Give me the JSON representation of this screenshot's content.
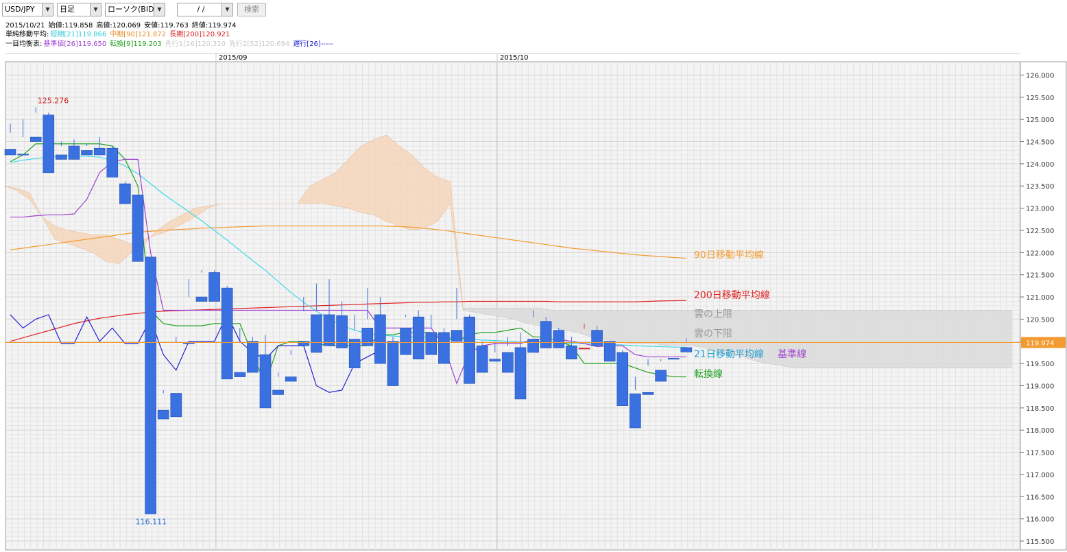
{
  "toolbar": {
    "pair": "USD/JPY",
    "period": "日足",
    "chart_kind": "ローソク(BID)",
    "date": "/ /",
    "search_label": "検索"
  },
  "info": {
    "date": "2015/10/21",
    "open": "始値:119.858",
    "high": "高値:120.069",
    "low": "安値:119.763",
    "close": "終値:119.974",
    "sma_label": "単純移動平均:",
    "sma_short": "短期[21]119.866",
    "sma_mid": "中期[90]121.872",
    "sma_long": "長期[200]120.921",
    "ichimoku_label": "一目均衡表:",
    "kijun": "基準値[26]119.650",
    "tenkan": "転換[9]119.203",
    "senkou1": "先行1[26]120.310",
    "senkou2": "先行2[52]120.694",
    "chikou": "遅行[26]-----"
  },
  "colors": {
    "up": "#e83030",
    "down": "#3a70e0",
    "sma21": "#40d8e8",
    "sma90": "#f39a30",
    "sma200": "#e02020",
    "kijun": "#a040d0",
    "tenkan": "#20a020",
    "chikou": "#2020d0",
    "cloud": "#f5d5bb",
    "cloud_gray": "#dcdcdc",
    "price_line": "#f39a30"
  },
  "chart_data": {
    "type": "candlestick",
    "pair": "USD/JPY",
    "months": [
      "2015/09",
      "2015/10"
    ],
    "ylim": [
      115.3,
      126.3
    ],
    "yticks": [
      "126.000",
      "125.500",
      "125.000",
      "124.500",
      "124.000",
      "123.500",
      "123.000",
      "122.500",
      "122.000",
      "121.500",
      "121.000",
      "120.500",
      "120.000",
      "119.500",
      "119.000",
      "118.500",
      "118.000",
      "117.500",
      "117.000",
      "116.500",
      "116.000",
      "115.500"
    ],
    "current_price": "119.974",
    "high_label": "125.276",
    "low_label": "116.111",
    "candles": [
      [
        124.33,
        124.9,
        124.7,
        124.2
      ],
      [
        124.22,
        125.0,
        124.6,
        124.2
      ],
      [
        124.6,
        125.276,
        125.15,
        124.5
      ],
      [
        125.1,
        125.15,
        124.2,
        123.8
      ],
      [
        124.2,
        124.5,
        124.4,
        124.1
      ],
      [
        124.4,
        124.55,
        124.3,
        124.1
      ],
      [
        124.3,
        124.45,
        124.4,
        124.2
      ],
      [
        124.35,
        124.6,
        124.35,
        124.2
      ],
      [
        124.35,
        124.4,
        123.9,
        123.7
      ],
      [
        123.55,
        123.6,
        123.15,
        123.1
      ],
      [
        123.3,
        123.3,
        122.0,
        121.8
      ],
      [
        121.9,
        121.9,
        118.45,
        116.111
      ],
      [
        118.45,
        118.9,
        118.83,
        118.25
      ],
      [
        118.83,
        120.1,
        119.97,
        118.3
      ],
      [
        119.97,
        121.4,
        121.0,
        119.95
      ],
      [
        121.0,
        121.6,
        121.55,
        120.9
      ],
      [
        121.55,
        121.6,
        121.2,
        120.9
      ],
      [
        121.2,
        121.25,
        119.35,
        119.15
      ],
      [
        119.3,
        120.3,
        120.0,
        119.2
      ],
      [
        120.0,
        120.1,
        119.7,
        119.3
      ],
      [
        119.7,
        120.15,
        119.05,
        118.5
      ],
      [
        118.9,
        119.3,
        119.2,
        118.8
      ],
      [
        119.2,
        119.8,
        119.7,
        119.1
      ],
      [
        120.0,
        121.0,
        120.68,
        119.9
      ],
      [
        120.6,
        121.3,
        120.7,
        119.75
      ],
      [
        120.6,
        121.4,
        120.55,
        119.9
      ],
      [
        120.58,
        120.9,
        120.26,
        119.85
      ],
      [
        120.05,
        120.6,
        120.25,
        119.4
      ],
      [
        120.3,
        121.2,
        120.5,
        119.9
      ],
      [
        120.6,
        121.0,
        120.0,
        119.5
      ],
      [
        120.0,
        120.1,
        119.95,
        119.0
      ],
      [
        120.3,
        120.6,
        120.55,
        119.7
      ],
      [
        120.55,
        120.7,
        120.15,
        119.6
      ],
      [
        120.2,
        120.6,
        120.3,
        119.7
      ],
      [
        120.2,
        120.3,
        120.0,
        119.5
      ],
      [
        120.25,
        121.2,
        120.5,
        120.0
      ],
      [
        120.55,
        120.6,
        119.9,
        119.05
      ],
      [
        119.9,
        120.0,
        119.75,
        119.3
      ],
      [
        119.6,
        120.0,
        119.75,
        119.55
      ],
      [
        119.75,
        120.1,
        119.9,
        119.3
      ],
      [
        119.86,
        120.2,
        119.85,
        118.7
      ],
      [
        120.05,
        120.7,
        120.55,
        119.75
      ],
      [
        120.45,
        120.55,
        120.15,
        119.85
      ],
      [
        120.25,
        120.3,
        120.0,
        119.85
      ],
      [
        119.9,
        120.1,
        119.75,
        119.6
      ],
      [
        119.85,
        120.4,
        120.28,
        119.85
      ],
      [
        120.25,
        120.35,
        120.1,
        119.9
      ],
      [
        120.0,
        120.0,
        119.72,
        119.55
      ],
      [
        119.75,
        119.8,
        118.85,
        118.55
      ],
      [
        118.82,
        119.2,
        118.9,
        118.05
      ],
      [
        118.85,
        119.6,
        119.45,
        118.8
      ],
      [
        119.35,
        119.6,
        119.55,
        119.1
      ],
      [
        119.62,
        120.0,
        119.97,
        119.6
      ],
      [
        119.86,
        120.07,
        119.97,
        119.76
      ]
    ],
    "sma21": [
      124.03,
      124.08,
      124.12,
      124.15,
      124.17,
      124.18,
      124.17,
      124.15,
      124.08,
      123.95,
      123.78,
      123.55,
      123.32,
      123.12,
      122.92,
      122.72,
      122.5,
      122.28,
      122.05,
      121.82,
      121.6,
      121.35,
      121.1,
      120.88,
      120.68,
      120.5,
      120.36,
      120.25,
      120.18,
      120.14,
      120.12,
      120.1,
      120.1,
      120.1,
      120.08,
      120.07,
      120.05,
      120.03,
      120.02,
      120.0,
      119.98,
      119.98,
      119.98,
      119.97,
      119.95,
      119.95,
      119.94,
      119.93,
      119.92,
      119.9,
      119.89,
      119.88,
      119.87,
      119.866
    ],
    "sma90": [
      122.06,
      122.1,
      122.14,
      122.18,
      122.22,
      122.26,
      122.3,
      122.34,
      122.38,
      122.42,
      122.46,
      122.48,
      122.5,
      122.52,
      122.53,
      122.55,
      122.56,
      122.57,
      122.58,
      122.59,
      122.6,
      122.6,
      122.6,
      122.6,
      122.6,
      122.6,
      122.6,
      122.6,
      122.6,
      122.6,
      122.59,
      122.58,
      122.56,
      122.53,
      122.5,
      122.46,
      122.42,
      122.38,
      122.34,
      122.3,
      122.26,
      122.22,
      122.18,
      122.14,
      122.1,
      122.07,
      122.04,
      122.01,
      121.98,
      121.95,
      121.93,
      121.91,
      121.89,
      121.872
    ],
    "sma200": [
      120.0,
      120.08,
      120.16,
      120.24,
      120.32,
      120.4,
      120.46,
      120.52,
      120.56,
      120.6,
      120.63,
      120.66,
      120.68,
      120.69,
      120.7,
      120.71,
      120.72,
      120.73,
      120.74,
      120.75,
      120.76,
      120.77,
      120.78,
      120.79,
      120.8,
      120.81,
      120.82,
      120.83,
      120.84,
      120.85,
      120.86,
      120.87,
      120.88,
      120.88,
      120.89,
      120.89,
      120.9,
      120.9,
      120.9,
      120.9,
      120.9,
      120.9,
      120.9,
      120.89,
      120.89,
      120.89,
      120.89,
      120.89,
      120.89,
      120.89,
      120.9,
      120.91,
      120.915,
      120.921
    ],
    "kijun": [
      122.8,
      122.8,
      122.83,
      122.85,
      122.85,
      122.87,
      123.2,
      123.8,
      124.05,
      124.1,
      124.1,
      122.0,
      120.7,
      120.7,
      120.7,
      120.7,
      120.7,
      120.7,
      120.7,
      120.7,
      120.7,
      120.7,
      120.7,
      120.7,
      120.7,
      120.7,
      120.7,
      120.7,
      120.7,
      120.3,
      120.3,
      120.3,
      120.3,
      120.3,
      119.9,
      119.05,
      119.75,
      119.9,
      119.95,
      119.95,
      119.95,
      120.05,
      120.05,
      120.05,
      120.0,
      119.95,
      119.88,
      119.9,
      119.9,
      119.7,
      119.65,
      119.65,
      119.65,
      119.65
    ],
    "tenkan": [
      124.05,
      124.2,
      124.45,
      124.45,
      124.45,
      124.45,
      124.45,
      124.45,
      124.4,
      124.1,
      123.5,
      120.7,
      120.4,
      120.35,
      120.35,
      120.35,
      120.4,
      120.4,
      120.4,
      119.7,
      119.05,
      119.9,
      120.0,
      120.0,
      119.95,
      119.9,
      119.9,
      119.9,
      119.9,
      120.15,
      120.15,
      120.2,
      120.2,
      120.2,
      120.1,
      120.0,
      120.15,
      120.2,
      120.2,
      120.25,
      120.3,
      120.1,
      120.1,
      120.0,
      119.9,
      119.5,
      119.5,
      119.5,
      119.5,
      119.4,
      119.3,
      119.25,
      119.2,
      119.2
    ],
    "chikou": [
      120.6,
      120.3,
      120.5,
      120.6,
      119.95,
      119.95,
      120.55,
      120.0,
      120.3,
      119.95,
      119.95,
      120.5,
      119.7,
      119.35,
      120.0,
      120.0,
      120.0,
      120.6,
      120.0,
      119.75,
      119.6,
      119.9,
      119.9,
      119.9,
      119.0,
      118.85,
      118.9,
      119.5,
      119.65,
      119.8
    ],
    "cloud_start_index": 0,
    "senkou_a": [
      123.5,
      123.4,
      123.2,
      122.8,
      122.3,
      122.2,
      122.1,
      122.0,
      121.8,
      121.75,
      122.0,
      122.2,
      122.5,
      122.7,
      122.85,
      123.0,
      123.05,
      123.1,
      123.1,
      123.1,
      123.1,
      123.1,
      123.1,
      123.1,
      123.5,
      123.65,
      123.8,
      124.1,
      124.4,
      124.55,
      124.65,
      124.4,
      124.2,
      123.9,
      123.7,
      123.6,
      120.75,
      120.75,
      120.75,
      120.75,
      120.75,
      120.75,
      120.75,
      120.7,
      120.7,
      120.7,
      120.7,
      120.7,
      120.7,
      120.7,
      120.7,
      120.7,
      120.7,
      120.7,
      120.7,
      120.7,
      120.7,
      120.7,
      120.7,
      120.7,
      120.7,
      120.7,
      120.7,
      120.7,
      120.7,
      120.7,
      120.7,
      120.7,
      120.7,
      120.7,
      120.7,
      120.7,
      120.7,
      120.7,
      120.7,
      120.7,
      120.7,
      120.7,
      120.7,
      120.7
    ],
    "senkou_b": [
      123.5,
      123.45,
      123.35,
      122.8,
      122.6,
      122.5,
      122.45,
      122.4,
      122.4,
      122.3,
      122.2,
      122.3,
      122.4,
      122.5,
      122.65,
      122.8,
      123.0,
      123.1,
      123.1,
      123.1,
      123.1,
      123.1,
      123.1,
      123.1,
      123.1,
      123.1,
      123.05,
      123.0,
      122.9,
      122.85,
      122.7,
      122.6,
      122.5,
      122.55,
      122.7,
      123.1,
      120.7,
      120.65,
      120.6,
      120.55,
      120.5,
      120.4,
      120.35,
      120.3,
      120.25,
      120.2,
      120.1,
      120.05,
      120.0,
      119.95,
      119.95,
      119.95,
      119.9,
      119.9,
      119.9,
      119.85,
      119.75,
      119.7,
      119.65,
      119.55,
      119.5,
      119.45,
      119.4,
      119.4,
      119.4,
      119.4,
      119.4,
      119.4,
      119.4,
      119.4,
      119.4,
      119.4,
      119.4,
      119.4,
      119.4,
      119.4,
      119.4,
      119.4,
      119.4,
      119.4
    ],
    "annotations": [
      {
        "text": "90日移動平均線",
        "value": 121.95,
        "color": "#f39a30"
      },
      {
        "text": "200日移動平均線",
        "value": 121.05,
        "color": "#e02020"
      },
      {
        "text": "雲の上限",
        "value": 120.62,
        "color": "#999999"
      },
      {
        "text": "雲の下限",
        "value": 120.18,
        "color": "#999999"
      },
      {
        "text": "21日移動平均線",
        "value": 119.72,
        "color": "#20a0d0"
      },
      {
        "text": "基準線",
        "value": 119.72,
        "color": "#a040d0"
      },
      {
        "text": "転換線",
        "value": 119.27,
        "color": "#20a020"
      }
    ]
  }
}
